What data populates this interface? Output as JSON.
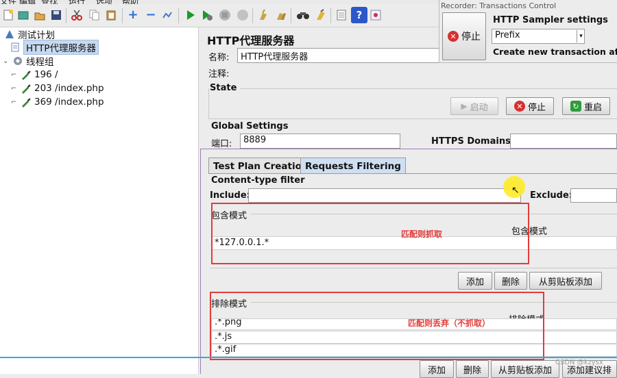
{
  "menubar": {
    "items": [
      "文件",
      "编辑",
      "查找",
      "运行",
      "选项",
      "帮助"
    ]
  },
  "toolbar": {
    "icons": [
      "new-icon",
      "templates-icon",
      "open-icon",
      "save-icon",
      "cut-icon",
      "copy-icon",
      "paste-icon",
      "expand-icon",
      "collapse-icon",
      "toggle-icon",
      "start-icon",
      "start-no-pause-icon",
      "stop-icon",
      "shutdown-icon",
      "clear-icon",
      "clear-all-icon",
      "search-icon",
      "reset-search-icon",
      "function-helper-icon",
      "help-icon",
      "ssl-manager-icon"
    ]
  },
  "tree": {
    "root": "测试计划",
    "proxy": "HTTP代理服务器",
    "thread_group": "线程组",
    "samplers": [
      "196 /",
      "203 /index.php",
      "369 /index.php"
    ]
  },
  "panel": {
    "title": "HTTP代理服务器",
    "name_label": "名称:",
    "name_value": "HTTP代理服务器",
    "comment_label": "注释:",
    "state_label": "State",
    "start_label": "启动",
    "stop_label": "停止",
    "restart_label": "重启",
    "global_label": "Global Settings",
    "port_label": "端口:",
    "port_value": "8889",
    "https_label": "HTTPS Domains:"
  },
  "tabs": [
    {
      "label": "Test Plan Creation",
      "active": false
    },
    {
      "label": "Requests Filtering",
      "active": true
    }
  ],
  "filter": {
    "content_type_label": "Content-type filter",
    "include_label": "Include:",
    "exclude_label": "Exclude:",
    "include_section": "包含模式",
    "include_col": "包含模式",
    "include_rows": [
      "*127.0.0.1.*"
    ],
    "include_annotation": "匹配则抓取",
    "add_label": "添加",
    "delete_label": "删除",
    "clipboard_label": "从剪贴板添加",
    "exclude_section": "排除模式",
    "exclude_col": "排除模式",
    "exclude_rows": [
      ".*.png",
      ".*.js",
      ".*.gif"
    ],
    "exclude_annotation": "匹配则丢弃（不抓取）",
    "add_suggested_label": "添加建议排"
  },
  "recorder": {
    "title": "Recorder: Transactions Control",
    "stop_label": "停止",
    "sampler_settings": "HTTP Sampler settings",
    "prefix_value": "Prefix",
    "create_txn": "Create new transaction after"
  },
  "watermark": "CSDN @kzysx",
  "colors": {
    "annotation": "#e23a3a",
    "selection": "#c6d9f0",
    "active_tab": "#cfdff3",
    "cursor_highlight": "#ffeb28",
    "progress_line": "#38a6e8"
  }
}
